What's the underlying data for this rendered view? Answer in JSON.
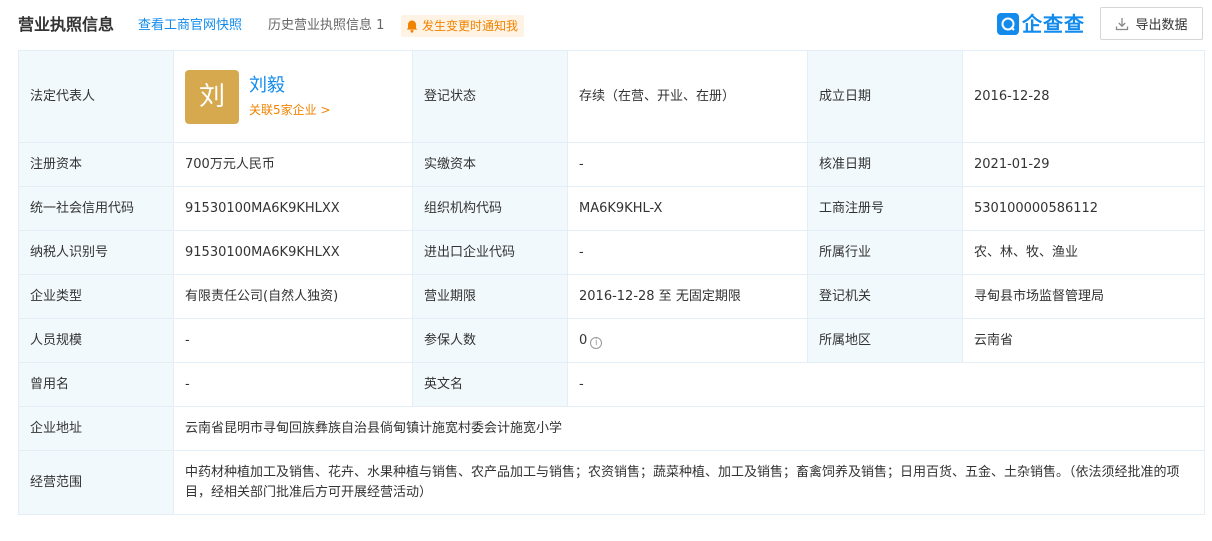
{
  "header": {
    "title": "营业执照信息",
    "snapshot_link": "查看工商官网快照",
    "history_link": "历史营业执照信息 1",
    "notify_label": "发生变更时通知我",
    "brand_name": "企查查",
    "export_label": "导出数据",
    "icons": {
      "notify": "bell-icon",
      "brand": "qcc-logo-icon",
      "export": "download-icon"
    }
  },
  "legal_rep": {
    "label": "法定代表人",
    "avatar_char": "刘",
    "name": "刘毅",
    "related": "关联5家企业 >"
  },
  "fields": {
    "reg_status": {
      "label": "登记状态",
      "value": "存续（在营、开业、在册）"
    },
    "found_date": {
      "label": "成立日期",
      "value": "2016-12-28"
    },
    "reg_capital": {
      "label": "注册资本",
      "value": "700万元人民币"
    },
    "paid_capital": {
      "label": "实缴资本",
      "value": "-"
    },
    "approve_date": {
      "label": "核准日期",
      "value": "2021-01-29"
    },
    "credit_code": {
      "label": "统一社会信用代码",
      "value": "91530100MA6K9KHLXX"
    },
    "org_code": {
      "label": "组织机构代码",
      "value": "MA6K9KHL-X"
    },
    "reg_no": {
      "label": "工商注册号",
      "value": "530100000586112"
    },
    "taxpayer_id": {
      "label": "纳税人识别号",
      "value": "91530100MA6K9KHLXX"
    },
    "ie_code": {
      "label": "进出口企业代码",
      "value": "-"
    },
    "industry": {
      "label": "所属行业",
      "value": "农、林、牧、渔业"
    },
    "company_type": {
      "label": "企业类型",
      "value": "有限责任公司(自然人独资)"
    },
    "biz_term": {
      "label": "营业期限",
      "value": "2016-12-28 至 无固定期限"
    },
    "reg_authority": {
      "label": "登记机关",
      "value": "寻甸县市场监督管理局"
    },
    "staff_size": {
      "label": "人员规模",
      "value": "-"
    },
    "insured": {
      "label": "参保人数",
      "value": "0"
    },
    "region": {
      "label": "所属地区",
      "value": "云南省"
    },
    "former_name": {
      "label": "曾用名",
      "value": "-"
    },
    "english_name": {
      "label": "英文名",
      "value": "-"
    },
    "address": {
      "label": "企业地址",
      "value": "云南省昆明市寻甸回族彝族自治县倘甸镇计施宽村委会计施宽小学"
    },
    "biz_scope": {
      "label": "经营范围",
      "value": "中药材种植加工及销售、花卉、水果种植与销售、农产品加工与销售；农资销售；蔬菜种植、加工及销售；畜禽饲养及销售；日用百货、五金、土杂销售。（依法须经批准的项目，经相关部门批准后方可开展经营活动）"
    }
  },
  "colors": {
    "accent": "#128bed",
    "warning": "#f08300",
    "label_bg": "#f2f9fc",
    "border": "#e4eef6",
    "avatar_bg": "#d6a94f"
  }
}
